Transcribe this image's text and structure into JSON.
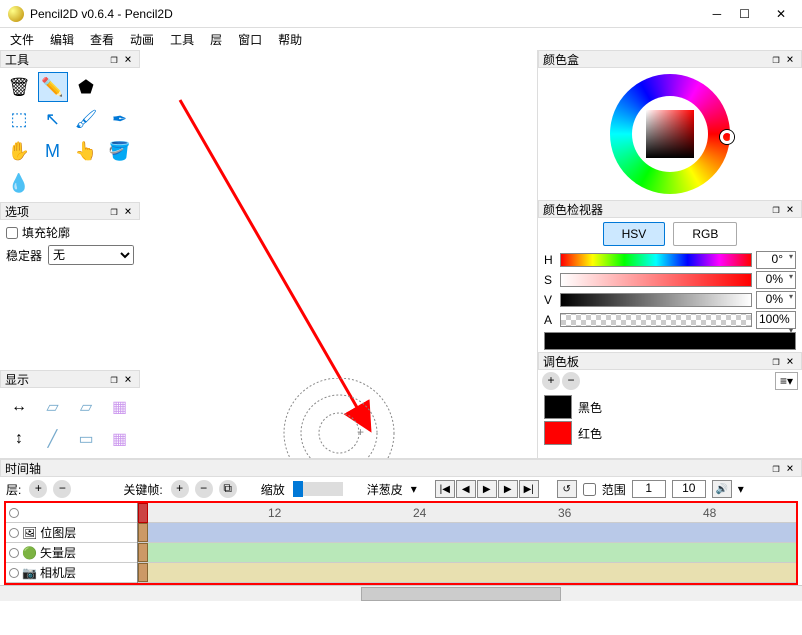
{
  "window": {
    "title": "Pencil2D v0.6.4 - Pencil2D"
  },
  "menu": {
    "file": "文件",
    "edit": "编辑",
    "view": "查看",
    "animation": "动画",
    "tools": "工具",
    "layer": "层",
    "window": "窗口",
    "help": "帮助"
  },
  "panels": {
    "tools": "工具",
    "options": "选项",
    "display": "显示",
    "colorbox": "颜色盒",
    "colorinspector": "颜色检视器",
    "palette": "调色板",
    "timeline": "时间轴"
  },
  "options": {
    "fill_outline": "填充轮廓",
    "stabilizer": "稳定器",
    "stabilizer_value": "无"
  },
  "color_tabs": {
    "hsv": "HSV",
    "rgb": "RGB"
  },
  "color": {
    "h": "0°",
    "s": "0%",
    "v": "0%",
    "a": "100%"
  },
  "palette_items": [
    {
      "name": "黑色",
      "hex": "#000000"
    },
    {
      "name": "红色",
      "hex": "#ff0000"
    }
  ],
  "timeline": {
    "layer_label": "层:",
    "keyframe_label": "关键帧:",
    "zoom_label": "缩放",
    "onion_label": "洋葱皮",
    "range_label": "范围",
    "range_start": "1",
    "range_end": "10",
    "ruler_marks": [
      "12",
      "24",
      "36",
      "48"
    ],
    "layers": [
      "位图层",
      "矢量层",
      "相机层"
    ]
  }
}
